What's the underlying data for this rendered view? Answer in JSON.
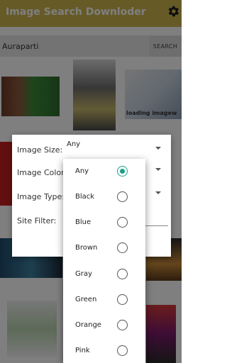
{
  "app": {
    "title": "Image Search Downloder"
  },
  "search": {
    "value": "Auraparti",
    "button_label": "SEARCH"
  },
  "dialog": {
    "image_size": {
      "label": "Image Size:",
      "value": "Any"
    },
    "image_color": {
      "label": "Image Color:"
    },
    "image_type": {
      "label": "Image Type:"
    },
    "site_filter": {
      "label": "Site Filter:"
    }
  },
  "color_options": [
    {
      "label": "Any",
      "selected": true
    },
    {
      "label": "Black",
      "selected": false
    },
    {
      "label": "Blue",
      "selected": false
    },
    {
      "label": "Brown",
      "selected": false
    },
    {
      "label": "Gray",
      "selected": false
    },
    {
      "label": "Green",
      "selected": false
    },
    {
      "label": "Orange",
      "selected": false
    },
    {
      "label": "Pink",
      "selected": false
    }
  ],
  "background_tiles": [
    {
      "caption": "loading imagew"
    }
  ],
  "colors": {
    "app_bar": "#cdb54e",
    "accent": "#1aa08a",
    "search_bg": "#e7e7e7"
  }
}
